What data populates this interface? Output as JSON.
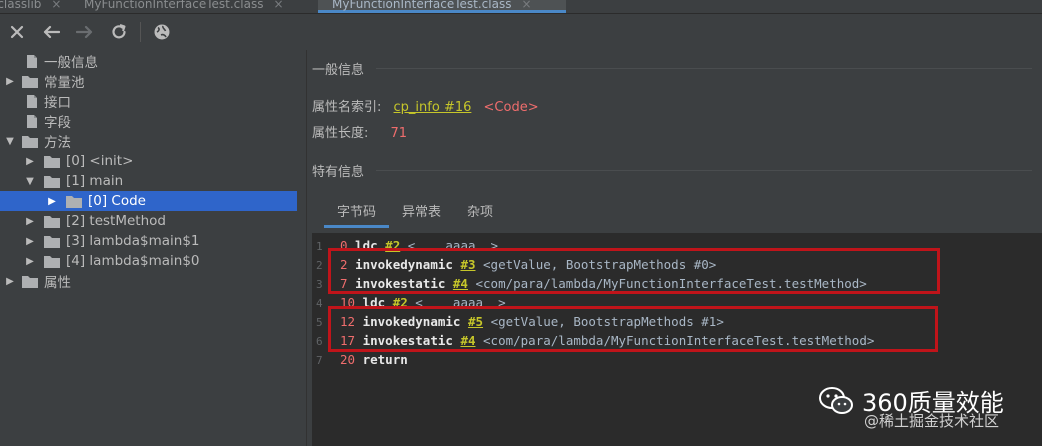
{
  "tabs": [
    {
      "label": "jclasslib",
      "close": "×"
    },
    {
      "label": "MyFunctionInterfaceTest.class",
      "close": "×"
    },
    {
      "label": "MyFunctionInterfaceTest.class",
      "close": "×"
    }
  ],
  "toolbar": {
    "buttons": [
      "close-icon",
      "back-arrow-icon",
      "forward-arrow-icon",
      "refresh-icon",
      "globe-icon"
    ]
  },
  "tree": {
    "items": [
      {
        "label": "一般信息",
        "arrow": ""
      },
      {
        "label": "常量池",
        "arrow": "▶"
      },
      {
        "label": "接口",
        "arrow": ""
      },
      {
        "label": "字段",
        "arrow": ""
      },
      {
        "label": "方法",
        "arrow": "▼"
      },
      {
        "label": "[0] <init>",
        "arrow": "▶"
      },
      {
        "label": "[1] main",
        "arrow": "▼"
      },
      {
        "label": "[0] Code",
        "arrow": "▶"
      },
      {
        "label": "[2] testMethod",
        "arrow": "▶"
      },
      {
        "label": "[3] lambda$main$1",
        "arrow": "▶"
      },
      {
        "label": "[4] lambda$main$0",
        "arrow": "▶"
      },
      {
        "label": "属性",
        "arrow": "▶"
      }
    ],
    "selected_index": 7
  },
  "general": {
    "title": "一般信息",
    "name_index_label": "属性名索引:",
    "name_index_link": "cp_info #16",
    "name_index_value": "<Code>",
    "length_label": "属性长度:",
    "length_value": "71"
  },
  "specific": {
    "title": "特有信息"
  },
  "subtabs": [
    "字节码",
    "异常表",
    "杂项"
  ],
  "bytecode": [
    {
      "num": "1",
      "offset": "0",
      "op": "ldc",
      "ref": "#2",
      "arg": "<    aaaa  >"
    },
    {
      "num": "2",
      "offset": "2",
      "op": "invokedynamic",
      "ref": "#3",
      "arg": "<getValue, BootstrapMethods #0>"
    },
    {
      "num": "3",
      "offset": "7",
      "op": "invokestatic",
      "ref": "#4",
      "arg": "<com/para/lambda/MyFunctionInterfaceTest.testMethod>"
    },
    {
      "num": "4",
      "offset": "10",
      "op": "ldc",
      "ref": "#2",
      "arg": "<    aaaa  >"
    },
    {
      "num": "5",
      "offset": "12",
      "op": "invokedynamic",
      "ref": "#5",
      "arg": "<getValue, BootstrapMethods #1>"
    },
    {
      "num": "6",
      "offset": "17",
      "op": "invokestatic",
      "ref": "#4",
      "arg": "<com/para/lambda/MyFunctionInterfaceTest.testMethod>"
    },
    {
      "num": "7",
      "offset": "20",
      "op": "return",
      "ref": "",
      "arg": ""
    }
  ],
  "watermark": {
    "brand": "360质量效能",
    "sub": "@稀土掘金技术社区"
  },
  "colors": {
    "selection": "#2f65ca",
    "annotation": "#c0141a",
    "link": "#c6c62a",
    "offset": "#ef6d6d"
  }
}
